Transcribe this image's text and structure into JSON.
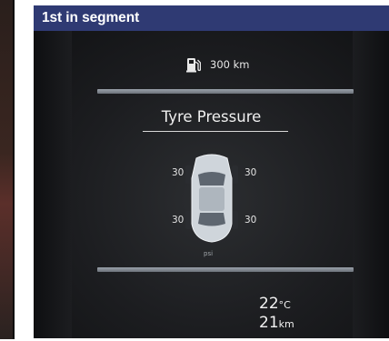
{
  "header": {
    "title": "1st in segment"
  },
  "dashboard": {
    "range": "300 km",
    "tyre_pressure_title": "Tyre Pressure",
    "tyres": {
      "front_left": "30",
      "front_right": "30",
      "rear_left": "30",
      "rear_right": "30"
    },
    "pressure_unit": "psi",
    "temperature_value": "22",
    "temperature_unit": "°C",
    "distance_value": "21",
    "distance_unit": "km"
  },
  "icons": {
    "fuel": "fuel-pump-icon",
    "car": "car-top-view-icon"
  },
  "colors": {
    "header_bg": "#2f3a73",
    "screen_bg": "#1a1b1d",
    "bar": "#8a9098"
  }
}
